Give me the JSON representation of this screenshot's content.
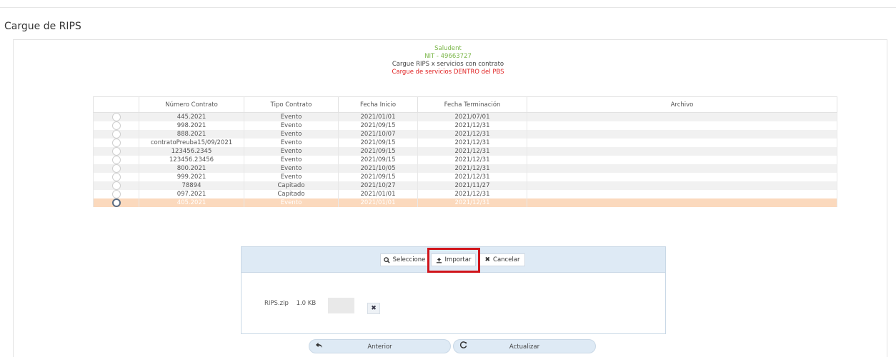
{
  "page": {
    "title": "Cargue de RIPS"
  },
  "header": {
    "company": "Saludent",
    "nit": "NIT - 49663727",
    "subtitle": "Cargue RIPS x servicios con contrato",
    "notice": "Cargue de servicios DENTRO del PBS",
    "colors": {
      "company": "#7ab648",
      "notice": "#e02020"
    }
  },
  "table": {
    "columns": [
      "",
      "Número Contrato",
      "Tipo Contrato",
      "Fecha Inicio",
      "Fecha Terminación",
      "Archivo"
    ],
    "rows": [
      {
        "contrato": "445.2021",
        "tipo": "Evento",
        "inicio": "2021/01/01",
        "fin": "2021/07/01",
        "selected": false
      },
      {
        "contrato": "998.2021",
        "tipo": "Evento",
        "inicio": "2021/09/15",
        "fin": "2021/12/31",
        "selected": false
      },
      {
        "contrato": "888.2021",
        "tipo": "Evento",
        "inicio": "2021/10/07",
        "fin": "2021/12/31",
        "selected": false
      },
      {
        "contrato": "contratoPreuba15/09/2021",
        "tipo": "Evento",
        "inicio": "2021/09/15",
        "fin": "2021/12/31",
        "selected": false
      },
      {
        "contrato": "123456.2345",
        "tipo": "Evento",
        "inicio": "2021/09/15",
        "fin": "2021/12/31",
        "selected": false
      },
      {
        "contrato": "123456.23456",
        "tipo": "Evento",
        "inicio": "2021/09/15",
        "fin": "2021/12/31",
        "selected": false
      },
      {
        "contrato": "800.2021",
        "tipo": "Evento",
        "inicio": "2021/10/05",
        "fin": "2021/12/31",
        "selected": false
      },
      {
        "contrato": "999.2021",
        "tipo": "Evento",
        "inicio": "2021/09/15",
        "fin": "2021/12/31",
        "selected": false
      },
      {
        "contrato": "78894",
        "tipo": "Capitado",
        "inicio": "2021/10/27",
        "fin": "2021/11/27",
        "selected": false
      },
      {
        "contrato": "097.2021",
        "tipo": "Capitado",
        "inicio": "2021/01/01",
        "fin": "2021/12/31",
        "selected": false
      },
      {
        "contrato": "405.2021",
        "tipo": "Evento",
        "inicio": "2021/01/01",
        "fin": "2021/12/31",
        "selected": true
      }
    ],
    "selected_color": "#fbd9bd"
  },
  "upload": {
    "seleccione_label": "Seleccione",
    "importar_label": "Importar",
    "cancelar_label": "Cancelar",
    "file_name": "RIPS.zip",
    "file_size": "1.0 KB",
    "highlight_color": "#d0151b"
  },
  "nav": {
    "anterior_label": "Anterior",
    "actualizar_label": "Actualizar"
  },
  "icons": {
    "search": "search-icon",
    "upload": "upload-icon",
    "close": "close-icon",
    "back": "reply-arrow-icon",
    "refresh": "refresh-icon"
  }
}
